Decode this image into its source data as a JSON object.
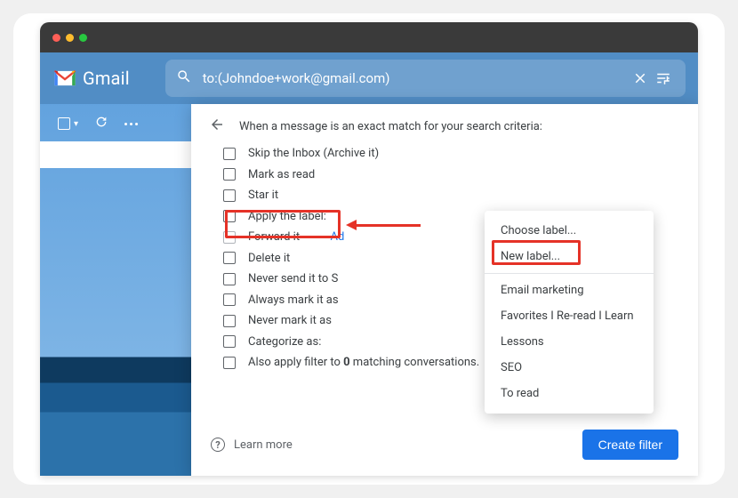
{
  "header": {
    "product": "Gmail",
    "search_query": "to:(Johndoe+work@gmail.com)"
  },
  "filter_panel": {
    "title": "When a message is an exact match for your search criteria:",
    "options": {
      "skip_inbox": "Skip the Inbox (Archive it)",
      "mark_read": "Mark as read",
      "star_it": "Star it",
      "apply_label": "Apply the label:",
      "forward_it": "Forward it",
      "forward_add": "Ad",
      "delete_it": "Delete it",
      "never_spam": "Never send it to S",
      "always_important": "Always mark it as",
      "never_important": "Never mark it as",
      "categorize": "Categorize as:",
      "also_apply_prefix": "Also apply filter to ",
      "also_apply_count": "0",
      "also_apply_suffix": " matching conversations."
    },
    "learn_more": "Learn more",
    "create_button": "Create filter"
  },
  "label_menu": {
    "choose": "Choose label...",
    "new": "New label...",
    "items": {
      "email_marketing": "Email marketing",
      "favorites": "Favorites I Re-read I Learn",
      "lessons": "Lessons",
      "seo": "SEO",
      "to_read": "To read"
    }
  }
}
